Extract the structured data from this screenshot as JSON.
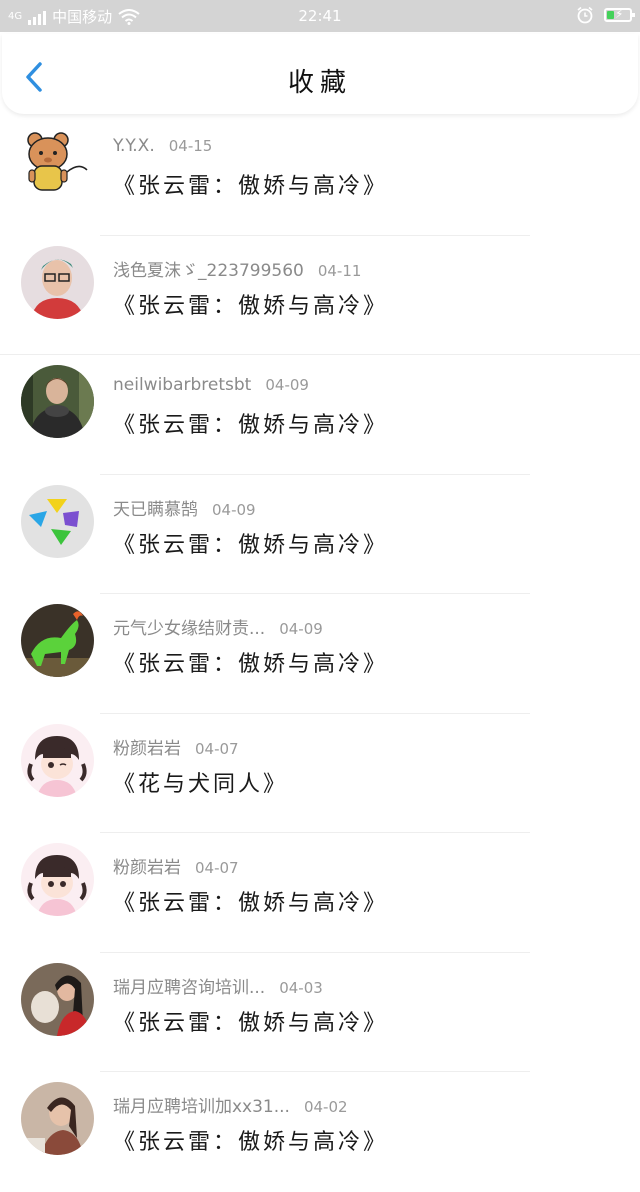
{
  "status_bar": {
    "carrier": "中国移动",
    "network": "4G",
    "time": "22:41",
    "battery_level": 0.3
  },
  "header": {
    "title": "收藏"
  },
  "favorites": [
    {
      "user": "Y.Y.X.",
      "date": "04-15",
      "work": "《张云雷：傲娇与高冷》"
    },
    {
      "user": "浅色夏沫ゞ_223799560",
      "date": "04-11",
      "work": "《张云雷：傲娇与高冷》"
    },
    {
      "user": "neilwibarbretsbt",
      "date": "04-09",
      "work": "《张云雷：傲娇与高冷》"
    },
    {
      "user": "天已瞒慕鹄",
      "date": "04-09",
      "work": "《张云雷：傲娇与高冷》"
    },
    {
      "user": "元气少女缘结财责...",
      "date": "04-09",
      "work": "《张云雷：傲娇与高冷》"
    },
    {
      "user": "粉颜岩岩",
      "date": "04-07",
      "work": "《花与犬同人》"
    },
    {
      "user": "粉颜岩岩",
      "date": "04-07",
      "work": "《张云雷：傲娇与高冷》"
    },
    {
      "user": "瑞月应聘咨询培训...",
      "date": "04-03",
      "work": "《张云雷：傲娇与高冷》"
    },
    {
      "user": "瑞月应聘培训加xx31...",
      "date": "04-02",
      "work": "《张云雷：傲娇与高冷》"
    }
  ],
  "colors": {
    "accent": "#2f8fe0",
    "status_bar": "#d4d4d4",
    "battery": "#44d15a"
  }
}
